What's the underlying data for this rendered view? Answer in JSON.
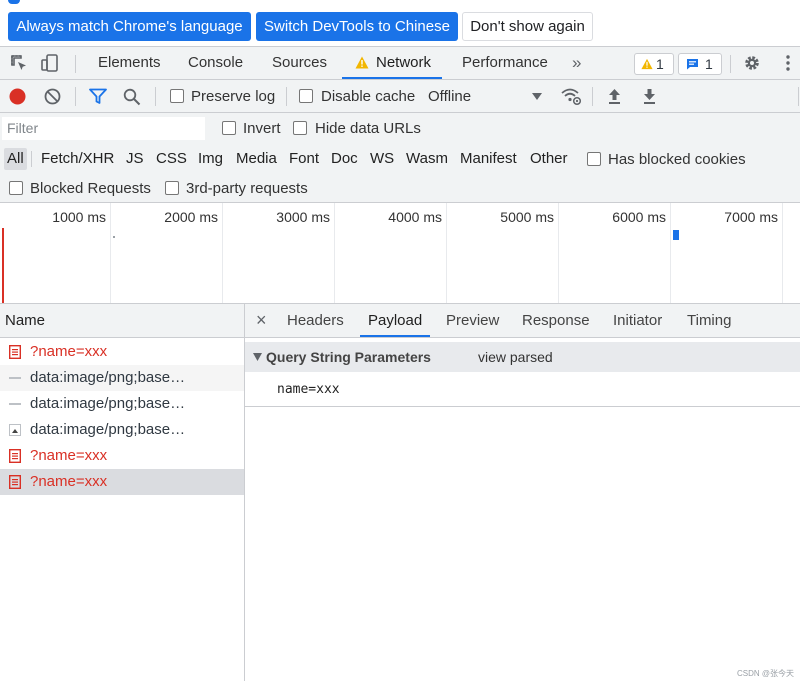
{
  "infobar": {
    "match_language": "Always match Chrome's language",
    "switch_chinese": "Switch DevTools to Chinese",
    "dont_show": "Don't show again"
  },
  "tabs": {
    "elements": "Elements",
    "console": "Console",
    "sources": "Sources",
    "network": "Network",
    "performance": "Performance",
    "more": "»",
    "warnings_count": "1",
    "messages_count": "1"
  },
  "toolbar": {
    "preserve_log": "Preserve log",
    "disable_cache": "Disable cache",
    "throttling": "Offline"
  },
  "filter": {
    "placeholder": "Filter",
    "invert": "Invert",
    "hide_data_urls": "Hide data URLs"
  },
  "types": [
    "All",
    "Fetch/XHR",
    "JS",
    "CSS",
    "Img",
    "Media",
    "Font",
    "Doc",
    "WS",
    "Wasm",
    "Manifest",
    "Other"
  ],
  "has_blocked_cookies": "Has blocked cookies",
  "blocked_requests": "Blocked Requests",
  "third_party": "3rd-party requests",
  "timeline": {
    "ticks": [
      "1000 ms",
      "2000 ms",
      "3000 ms",
      "4000 ms",
      "5000 ms",
      "6000 ms",
      "7000 ms"
    ]
  },
  "requests": {
    "header": "Name",
    "rows": [
      {
        "name": "?name=xxx",
        "status": "error",
        "icon": "document-icon"
      },
      {
        "name": "data:image/png;base…",
        "status": "ok",
        "icon": "image-dash-icon"
      },
      {
        "name": "data:image/png;base…",
        "status": "ok",
        "icon": "image-dash-icon"
      },
      {
        "name": "data:image/png;base…",
        "status": "ok",
        "icon": "image-thumb-icon"
      },
      {
        "name": "?name=xxx",
        "status": "error",
        "icon": "document-icon"
      },
      {
        "name": "?name=xxx",
        "status": "error",
        "icon": "document-icon"
      }
    ]
  },
  "detail": {
    "close": "×",
    "tabs": [
      "Headers",
      "Payload",
      "Preview",
      "Response",
      "Initiator",
      "Timing"
    ],
    "section_title": "Query String Parameters",
    "view_parsed": "view parsed",
    "param": "name=xxx"
  },
  "watermark": "CSDN @张今天",
  "colors": {
    "accent": "#1a73e8",
    "error": "#d93025",
    "record": "#d93025",
    "warning": "#f2b600"
  }
}
